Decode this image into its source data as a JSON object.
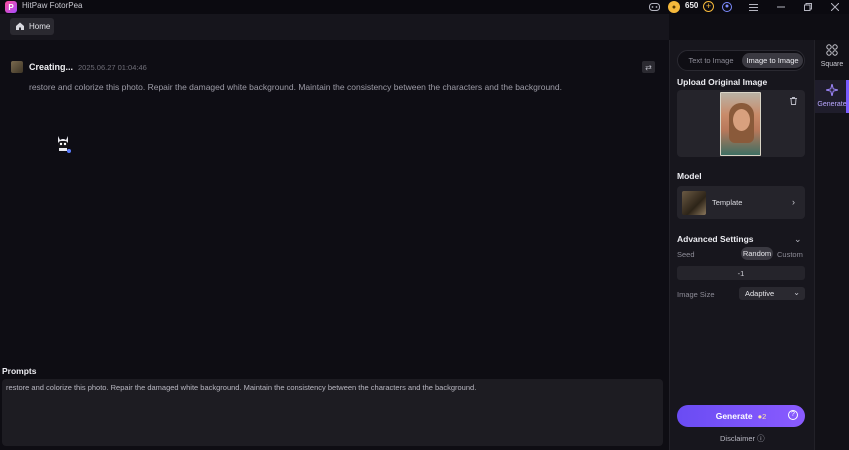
{
  "app": {
    "title": "HitPaw FotorPea",
    "logo": "P"
  },
  "titlebar": {
    "coins": "650",
    "icons": [
      "gamepad-icon",
      "coin-icon",
      "add-coin-icon",
      "user-icon",
      "menu-icon",
      "minimize-icon",
      "restore-icon",
      "close-icon"
    ]
  },
  "nav": {
    "home_label": "Home"
  },
  "task": {
    "status": "Creating...",
    "date": "2025.06.27  01:04:46",
    "prompt": "restore and colorize this photo. Repair the damaged white background. Maintain the consistency between the characters and the background."
  },
  "prompts": {
    "label": "Prompts",
    "value": "restore and colorize this photo. Repair the damaged white background. Maintain the consistency between the characters and the background."
  },
  "panel": {
    "tabs": [
      {
        "label": "Text to Image",
        "active": false
      },
      {
        "label": "Image to Image",
        "active": true
      }
    ],
    "upload_title": "Upload Original Image",
    "model_title": "Model",
    "model_name": "Template",
    "advanced_title": "Advanced Settings",
    "seed_label": "Seed",
    "seed_options": [
      "Random",
      "Custom"
    ],
    "seed_value": "-1",
    "image_size_label": "Image Size",
    "image_size_value": "Adaptive",
    "generate_label": "Generate",
    "generate_cost": "2",
    "disclaimer": "Disclaimer"
  },
  "rail": {
    "items": [
      {
        "label": "Square",
        "icon": "grid-icon"
      },
      {
        "label": "Generate",
        "icon": "sparkle-icon"
      }
    ]
  },
  "colors": {
    "accent": "#7a5cff",
    "background": "#0e0d13",
    "panel": "#17161d",
    "coin": "#f6b93b"
  }
}
